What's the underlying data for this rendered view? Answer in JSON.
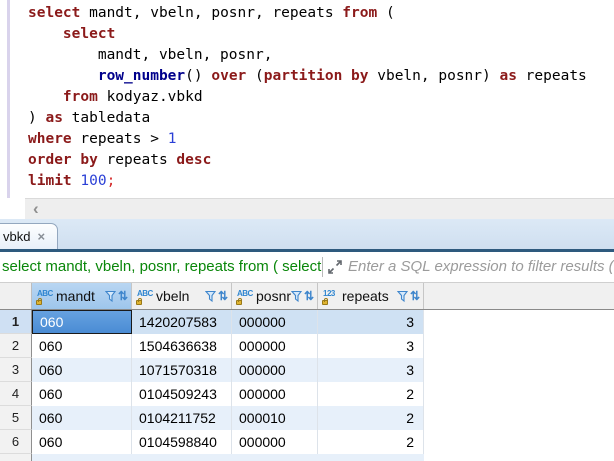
{
  "editor": {
    "lines": [
      {
        "segments": [
          {
            "t": "select",
            "c": "kw"
          },
          {
            "t": " mandt, vbeln, posnr, repeats ",
            "c": "pl"
          },
          {
            "t": "from",
            "c": "kw"
          },
          {
            "t": " (",
            "c": "pl"
          }
        ]
      },
      {
        "segments": [
          {
            "t": "    ",
            "c": "pl"
          },
          {
            "t": "select",
            "c": "kw"
          }
        ]
      },
      {
        "segments": [
          {
            "t": "        mandt, vbeln, posnr,",
            "c": "pl"
          }
        ]
      },
      {
        "segments": [
          {
            "t": "        ",
            "c": "pl"
          },
          {
            "t": "row_number",
            "c": "fn"
          },
          {
            "t": "() ",
            "c": "pl"
          },
          {
            "t": "over",
            "c": "kw"
          },
          {
            "t": " (",
            "c": "pl"
          },
          {
            "t": "partition by",
            "c": "kw"
          },
          {
            "t": " vbeln, posnr) ",
            "c": "pl"
          },
          {
            "t": "as",
            "c": "kw"
          },
          {
            "t": " repeats",
            "c": "pl"
          }
        ]
      },
      {
        "segments": [
          {
            "t": "    ",
            "c": "pl"
          },
          {
            "t": "from",
            "c": "kw"
          },
          {
            "t": " kodyaz.vbkd",
            "c": "pl"
          }
        ]
      },
      {
        "segments": [
          {
            "t": ") ",
            "c": "pl"
          },
          {
            "t": "as",
            "c": "kw"
          },
          {
            "t": " tabledata",
            "c": "pl"
          }
        ]
      },
      {
        "segments": [
          {
            "t": "where",
            "c": "kw"
          },
          {
            "t": " repeats > ",
            "c": "pl"
          },
          {
            "t": "1",
            "c": "num"
          }
        ]
      },
      {
        "segments": [
          {
            "t": "order by",
            "c": "kw"
          },
          {
            "t": " repeats ",
            "c": "pl"
          },
          {
            "t": "desc",
            "c": "kw"
          }
        ]
      },
      {
        "segments": [
          {
            "t": "limit",
            "c": "kw"
          },
          {
            "t": " ",
            "c": "pl"
          },
          {
            "t": "100",
            "c": "num"
          },
          {
            "t": ";",
            "c": "delim"
          }
        ]
      }
    ]
  },
  "scrollbar": {
    "left_arrow": "‹"
  },
  "results_tab": {
    "label": "vbkd",
    "close_glyph": "×"
  },
  "filter_bar": {
    "query_preview": "select mandt, vbeln, posnr, repeats from ( select",
    "placeholder": "Enter a SQL expression to filter results (use"
  },
  "grid": {
    "sort_glyph": "⇅",
    "columns": [
      {
        "name": "mandt",
        "label": "mandt",
        "type_icon": "ABC",
        "selected": true
      },
      {
        "name": "vbeln",
        "label": "vbeln",
        "type_icon": "ABC",
        "selected": false
      },
      {
        "name": "posnr",
        "label": "posnr",
        "type_icon": "ABC",
        "selected": false
      },
      {
        "name": "repeats",
        "label": "repeats",
        "type_icon": "123",
        "selected": false
      }
    ],
    "rows": [
      {
        "num": "1",
        "cells": [
          "060",
          "1420207583",
          "000000",
          "3"
        ],
        "selected": true
      },
      {
        "num": "2",
        "cells": [
          "060",
          "1504636638",
          "000000",
          "3"
        ],
        "selected": false
      },
      {
        "num": "3",
        "cells": [
          "060",
          "1071570318",
          "000000",
          "3"
        ],
        "selected": false
      },
      {
        "num": "4",
        "cells": [
          "060",
          "0104509243",
          "000000",
          "2"
        ],
        "selected": false
      },
      {
        "num": "5",
        "cells": [
          "060",
          "0104211752",
          "000010",
          "2"
        ],
        "selected": false
      },
      {
        "num": "6",
        "cells": [
          "060",
          "0104598840",
          "000000",
          "2"
        ],
        "selected": false
      }
    ]
  },
  "colors": {
    "keyword": "#8b1a1a",
    "function_name": "#00008b",
    "number_literal": "#2a3fd6",
    "filter_query_green": "#0a870a",
    "selected_cell_blue": "#4a8cd4",
    "selected_row_highlight": "#cfe1f3",
    "zebra_row": "#e7f0fa",
    "selected_header": "#a9cdee",
    "tab_accent_line": "#2e5a7e"
  }
}
